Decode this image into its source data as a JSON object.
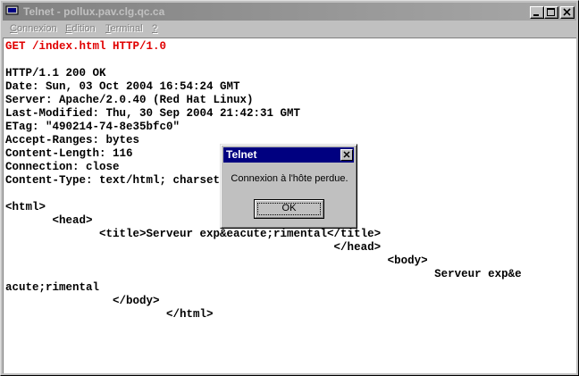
{
  "window": {
    "title": "Telnet - pollux.pav.clg.qc.ca",
    "icon": "terminal-icon"
  },
  "menu": {
    "items": [
      {
        "label": "onnexion",
        "accel": "C"
      },
      {
        "label": "dition",
        "accel": "E"
      },
      {
        "label": "erminal",
        "accel": "T"
      },
      {
        "label": "",
        "accel": "?"
      }
    ]
  },
  "terminal": {
    "lines": [
      {
        "text": "GET /index.html HTTP/1.0",
        "color": "red"
      },
      {
        "text": "",
        "color": "black"
      },
      {
        "text": "HTTP/1.1 200 OK",
        "color": "black"
      },
      {
        "text": "Date: Sun, 03 Oct 2004 16:54:24 GMT",
        "color": "black"
      },
      {
        "text": "Server: Apache/2.0.40 (Red Hat Linux)",
        "color": "black"
      },
      {
        "text": "Last-Modified: Thu, 30 Sep 2004 21:42:31 GMT",
        "color": "black"
      },
      {
        "text": "ETag: \"490214-74-8e35bfc0\"",
        "color": "black"
      },
      {
        "text": "Accept-Ranges: bytes",
        "color": "black"
      },
      {
        "text": "Content-Length: 116",
        "color": "black"
      },
      {
        "text": "Connection: close",
        "color": "black"
      },
      {
        "text": "Content-Type: text/html; charset=ISO-8859-1",
        "color": "black"
      },
      {
        "text": "",
        "color": "black"
      },
      {
        "text": "<html>",
        "color": "black"
      },
      {
        "text": "       <head>",
        "color": "black"
      },
      {
        "text": "              <title>Serveur exp&eacute;rimental</title>",
        "color": "black"
      },
      {
        "text": "                                                 </head>",
        "color": "black"
      },
      {
        "text": "                                                         <body>",
        "color": "black"
      },
      {
        "text": "                                                                Serveur exp&e",
        "color": "black"
      },
      {
        "text": "acute;rimental",
        "color": "black"
      },
      {
        "text": "                </body>",
        "color": "black"
      },
      {
        "text": "                        </html>",
        "color": "black"
      }
    ]
  },
  "dialog": {
    "title": "Telnet",
    "message": "Connexion à l'hôte perdue.",
    "ok_label": "OK"
  },
  "colors": {
    "titlebar_inactive": "#808080",
    "dialog_titlebar": "#000080",
    "request_text": "#e00000"
  }
}
